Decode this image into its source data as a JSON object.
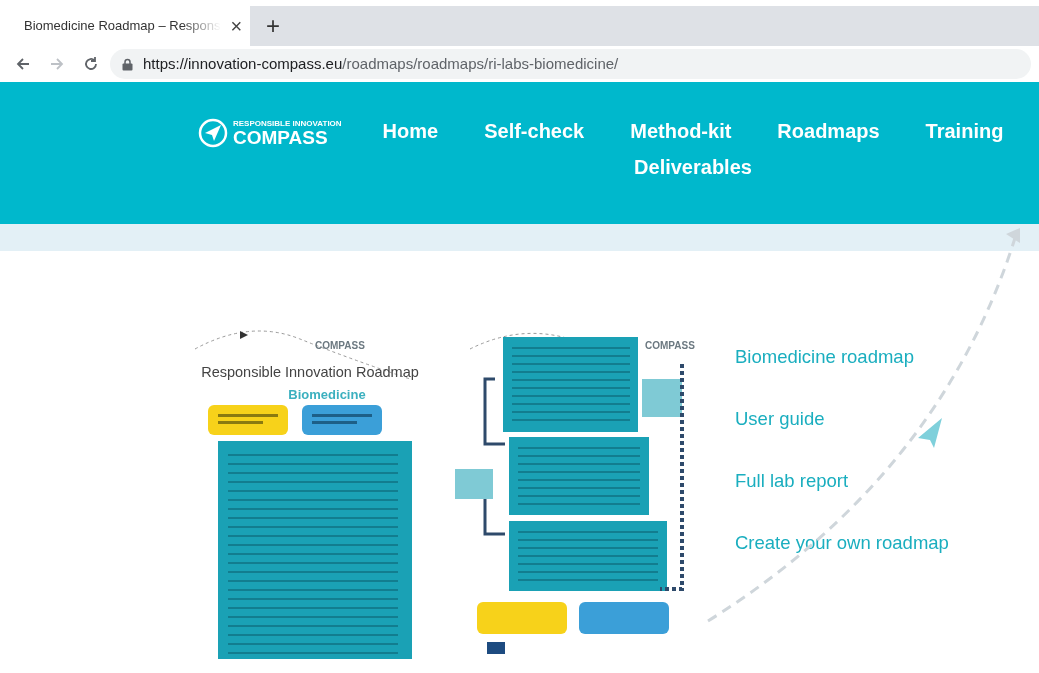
{
  "browser": {
    "tab": {
      "title": "Biomedicine Roadmap – Respons",
      "close": "×"
    },
    "new_tab": "+",
    "buttons": [
      {
        "kind": "back",
        "disabled": false
      },
      {
        "kind": "forward",
        "disabled": true
      },
      {
        "kind": "reload",
        "disabled": false
      }
    ],
    "url_host": "https://innovation-compass.eu",
    "url_path": "/roadmaps/roadmaps/ri-labs-biomedicine/"
  },
  "header": {
    "logo": {
      "tagline": "RESPONSIBLE INNOVATION",
      "name": "COMPASS"
    },
    "nav": [
      {
        "label": "Home"
      },
      {
        "label": "Self-check"
      },
      {
        "label": "Method-kit"
      },
      {
        "label": "Roadmaps"
      },
      {
        "label": "Training"
      },
      {
        "label": "Deliverables"
      }
    ]
  },
  "document": {
    "logo": "COMPASS",
    "title": "Responsible Innovation Roadmap",
    "subtitle": "Biomedicine",
    "logo_2": "COMPASS"
  },
  "links": [
    {
      "label": "Biomedicine roadmap"
    },
    {
      "label": "User guide"
    },
    {
      "label": "Full lab report"
    },
    {
      "label": "Create your own roadmap"
    }
  ]
}
